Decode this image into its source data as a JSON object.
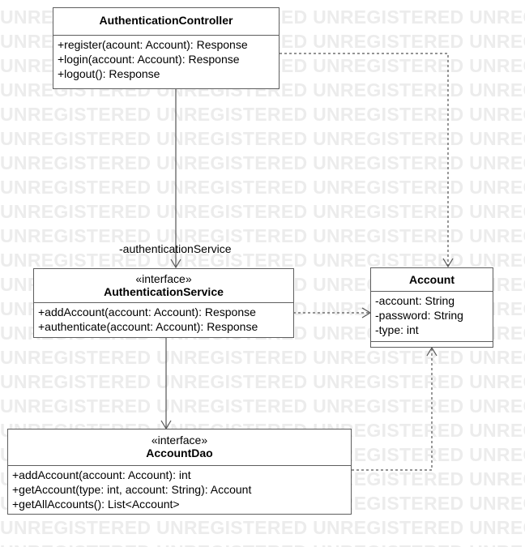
{
  "watermark": {
    "text": "UNREGISTERED"
  },
  "classes": {
    "auth_controller": {
      "stereotype": "",
      "name": "AuthenticationController",
      "operations": [
        "+register(acount: Account): Response",
        "+login(account: Account): Response",
        "+logout(): Response"
      ]
    },
    "auth_service": {
      "stereotype": "«interface»",
      "name": "AuthenticationService",
      "operations": [
        "+addAccount(account: Account): Response",
        "+authenticate(account: Account): Response"
      ]
    },
    "account": {
      "stereotype": "",
      "name": "Account",
      "attributes": [
        "-account: String",
        "-password: String",
        "-type: int"
      ]
    },
    "account_dao": {
      "stereotype": "«interface»",
      "name": "AccountDao",
      "operations": [
        "+addAccount(account: Account): int",
        "+getAccount(type: int, account: String): Account",
        "+getAllAccounts(): List<Account>"
      ]
    }
  },
  "associations": {
    "controller_to_service": {
      "role": "-authenticationService"
    }
  },
  "colors": {
    "border": "#5e5e5e",
    "watermark": "#ececec",
    "line": "#555555"
  }
}
